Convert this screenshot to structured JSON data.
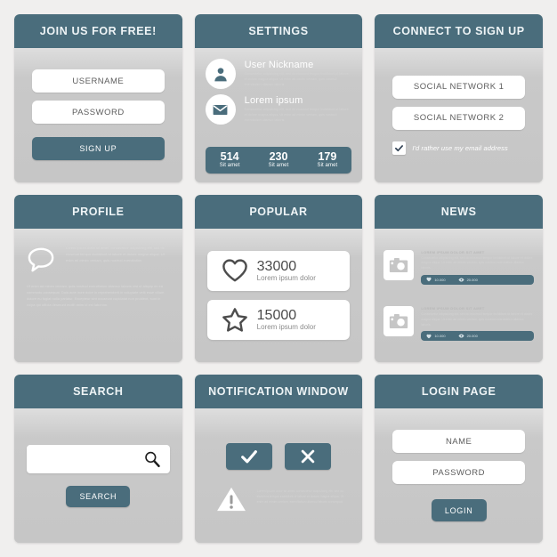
{
  "theme": {
    "teal": "#4a6d7c",
    "card_bg": "#c9c9c9",
    "page_bg": "#f0efee",
    "white": "#ffffff"
  },
  "cards": {
    "join": {
      "title": "JOIN US FOR FREE!",
      "username_placeholder": "USERNAME",
      "password_placeholder": "PASSWORD",
      "signup_label": "SIGN UP"
    },
    "settings": {
      "title": "SETTINGS",
      "rows": [
        {
          "icon": "user-icon",
          "title": "User Nickname",
          "text": "Consectetur adipisicing elit, sed do eiusmod tempor incididunt ut labore et dolore magna aliqua. Ut enim ad minim veniam, quis nostrud exercitation ullamco laboris."
        },
        {
          "icon": "envelope-icon",
          "title": "Lorem ipsum",
          "text": "Consectetur adipisicing elit, sed do eiusmod tempor incididunt ut labore et dolore magna aliqua. Ut enim ad minim veniam, quis nostrud exercitation ullamco laboris."
        }
      ],
      "stats": [
        {
          "value": "514",
          "label": "Sit amet"
        },
        {
          "value": "230",
          "label": "Sit amet"
        },
        {
          "value": "179",
          "label": "Sit amet"
        }
      ]
    },
    "connect": {
      "title": "CONNECT TO SIGN UP",
      "social_1": "SOCIAL NETWORK 1",
      "social_2": "SOCIAL NETWORK 2",
      "checkbox_label": "I'd rather use my email address",
      "checkbox_checked": true
    },
    "profile": {
      "title": "PROFILE",
      "icon": "speech-bubble-icon",
      "text_top": "Lorem ipsum dolor sit amet, consectetur adipisicing elit, sed do eiusmod tempor incididunt ut labore et dolore magna aliqua. Ut enim ad minim veniam, quis nostrud exercitation.",
      "text_bottom": "Ut enim ad minim veniam, quis nostrud exercitation ullamco laboris nisi ut aliquip ex ea commodo consequat. Duis aute irure dolor in reprehenderit in voluptate velit esse cillum dolore eu fugiat nulla pariatur. Excepteur sint occaecat cupidatat non proident, sunt in culpa qui officia deserunt mollit anim id est laborum."
    },
    "popular": {
      "title": "POPULAR",
      "items": [
        {
          "icon": "heart-icon",
          "value": "33000",
          "label": "Lorem ipsum dolor"
        },
        {
          "icon": "star-icon",
          "value": "15000",
          "label": "Lorem ipsum dolor"
        }
      ]
    },
    "news": {
      "title": "NEWS",
      "items": [
        {
          "icon": "camera-icon",
          "headline": "LOREM IPSUM DOLOR SIT AMET",
          "text": "Consectetur adipisicing elit, sed do eiusmod tempor incididunt ut labore et dolore magna aliqua. Ut enim ad minim veniam, quis nostrud exercitation ullamco laboris.",
          "likes": "10.000",
          "views": "20.000"
        },
        {
          "icon": "camera-icon",
          "headline": "LOREM IPSUM DOLOR SIT AMET",
          "text": "Consectetur adipisicing elit, sed do eiusmod tempor incididunt ut labore et dolore magna aliqua. Ut enim ad minim veniam, quis nostrud exercitation ullamco laboris.",
          "likes": "10.000",
          "views": "20.000"
        }
      ]
    },
    "search": {
      "title": "SEARCH",
      "input_value": "",
      "input_placeholder": "",
      "icon": "magnifier-icon",
      "button_label": "SEARCH"
    },
    "notification": {
      "title": "NOTIFICATION WINDOW",
      "accept_icon": "check-icon",
      "decline_icon": "close-icon",
      "warning_icon": "warning-triangle-icon",
      "message": "Lorem ipsum dolor sit amet, consectetur adipisicing elit, sed do eiusmod tempor incididunt ut labore et dolore magna aliqua. Ut enim ad minim veniam, exercitation ullamco laboris consequat."
    },
    "login": {
      "title": "LOGIN PAGE",
      "name_placeholder": "NAME",
      "password_placeholder": "PASSWORD",
      "login_label": "LOGIN"
    }
  }
}
